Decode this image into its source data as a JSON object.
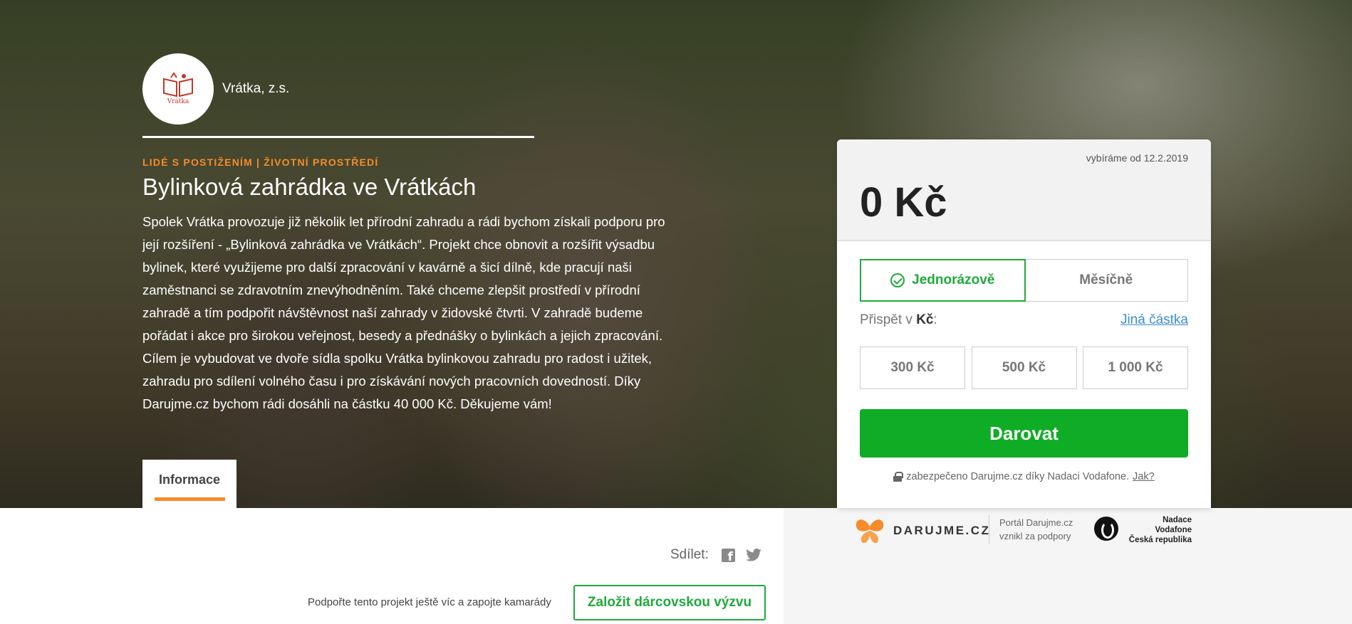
{
  "organization": {
    "name": "Vrátka, z.s.",
    "logo_text": "Vrátka"
  },
  "project": {
    "categories": "LIDÉ S POSTIŽENÍM | ŽIVOTNÍ PROSTŘEDÍ",
    "title": "Bylinková zahrádka ve Vrátkách",
    "description": "Spolek Vrátka provozuje již několik let přírodní zahradu a rádi bychom získali podporu pro její rozšíření - „Bylinková zahrádka ve Vrátkách“. Projekt chce obnovit a rozšířit výsadbu bylinek, které využijeme pro další zpracování v kavárně a šicí dílně, kde pracují naši zaměstnanci se zdravotním znevýhodněním. Také chceme zlepšit prostředí v přírodní zahradě a tím podpořit návštěvnost naší zahrady v židovské čtvrti. V zahradě budeme pořádat i akce pro širokou veřejnost, besedy a přednášky o bylinkách a jejich zpracování. Cílem je vybudovat ve dvoře sídla spolku Vrátka bylinkovou zahradu pro radost i užitek, zahradu pro sdílení volného času i pro získávání nových pracovních dovedností. Díky Darujme.cz bychom rádi dosáhli na částku 40 000 Kč. Děkujeme vám!"
  },
  "tabs": {
    "info": "Informace"
  },
  "donation": {
    "collecting_since": "vybíráme od 12.2.2019",
    "amount": "0 Kč",
    "frequency": {
      "one_time": "Jednorázově",
      "monthly": "Měsíčně",
      "selected": "one_time"
    },
    "contribute_prefix": "Přispět v ",
    "contribute_currency": "Kč",
    "contribute_suffix": ":",
    "other_amount": "Jiná částka",
    "presets": [
      "300 Kč",
      "500 Kč",
      "1 000 Kč"
    ],
    "donate_button": "Darovat",
    "secure_text": "zabezpečeno Darujme.cz díky Nadaci Vodafone.",
    "secure_link": "Jak?"
  },
  "footer": {
    "darujme_brand": "DARUJME.CZ",
    "portal_line1": "Portál Darujme.cz",
    "portal_line2": "vznikl za podpory",
    "vodafone_line1": "Nadace",
    "vodafone_line2": "Vodafone",
    "vodafone_line3": "Česká republika"
  },
  "share": {
    "label": "Sdílet:"
  },
  "challenge": {
    "support_text": "Podpořte tento projekt ještě víc a zapojte kamarády",
    "button": "Založit dárcovskou výzvu"
  },
  "colors": {
    "accent_orange": "#f58c2a",
    "donate_green": "#0fac26",
    "link_blue": "#3a8fd6"
  }
}
